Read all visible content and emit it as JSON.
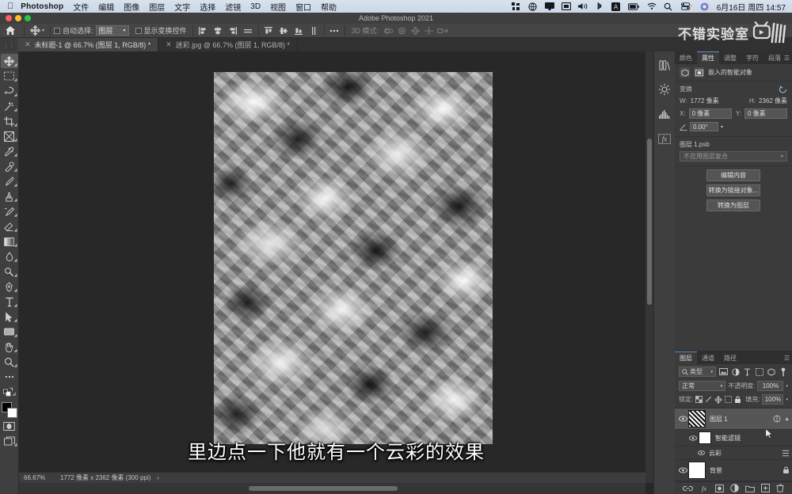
{
  "macbar": {
    "apple": "apple-logo",
    "app_name": "Photoshop",
    "menus": [
      "文件",
      "编辑",
      "图像",
      "图层",
      "文字",
      "选择",
      "滤镜",
      "3D",
      "视图",
      "窗口",
      "帮助"
    ],
    "status_icons": [
      "grid-icon",
      "globe-icon",
      "display-icon",
      "screen-icon",
      "volume-icon",
      "bluetooth-icon",
      "input-source-icon",
      "battery-icon",
      "wifi-icon",
      "search-icon",
      "control-center-icon",
      "siri-icon"
    ],
    "clock": "6月16日 周四  14:57"
  },
  "titlebar": {
    "title": "Adobe Photoshop 2021"
  },
  "optionsbar": {
    "home_icon": "home-icon",
    "tool_icon": "move-tool-icon",
    "auto_select_label": "自动选择:",
    "auto_select_value": "图层",
    "show_transform_label": "显示变换控件",
    "align_icons": [
      "align-left-icon",
      "align-center-h-icon",
      "align-right-icon",
      "distribute-h-icon",
      "align-top-icon",
      "align-middle-v-icon",
      "align-bottom-icon",
      "distribute-v-icon"
    ],
    "more_icon": "more-options-icon",
    "three_d_label": "3D 模式:",
    "three_d_icons": [
      "orbit-3d-icon",
      "roll-3d-icon",
      "pan-3d-icon",
      "slide-3d-icon",
      "scale-3d-icon"
    ]
  },
  "tabs": [
    {
      "label": "未标题-1 @ 66.7% (图层 1, RGB/8) *",
      "active": true
    },
    {
      "label": "迷彩.jpg @ 66.7% (图层 1, RGB/8) *",
      "active": false
    }
  ],
  "toolbar": {
    "tools": [
      {
        "name": "move-tool",
        "selected": true
      },
      {
        "name": "marquee-tool",
        "selected": false
      },
      {
        "name": "lasso-tool",
        "selected": false
      },
      {
        "name": "magic-wand-tool",
        "selected": false
      },
      {
        "name": "crop-tool",
        "selected": false
      },
      {
        "name": "frame-tool",
        "selected": false
      },
      {
        "name": "eyedropper-tool",
        "selected": false
      },
      {
        "name": "healing-brush-tool",
        "selected": false
      },
      {
        "name": "brush-tool",
        "selected": false
      },
      {
        "name": "clone-stamp-tool",
        "selected": false
      },
      {
        "name": "history-brush-tool",
        "selected": false
      },
      {
        "name": "eraser-tool",
        "selected": false
      },
      {
        "name": "gradient-tool",
        "selected": false
      },
      {
        "name": "blur-tool",
        "selected": false
      },
      {
        "name": "dodge-tool",
        "selected": false
      },
      {
        "name": "pen-tool",
        "selected": false
      },
      {
        "name": "type-tool",
        "selected": false
      },
      {
        "name": "path-selection-tool",
        "selected": false
      },
      {
        "name": "shape-tool",
        "selected": false
      },
      {
        "name": "hand-tool",
        "selected": false
      },
      {
        "name": "zoom-tool",
        "selected": false
      },
      {
        "name": "edit-toolbar",
        "selected": false
      }
    ],
    "foreground_color": "#000000",
    "background_color": "#ffffff",
    "quick_mask": "quick-mask-icon",
    "screen_mode": "screen-mode-icon"
  },
  "watermark": {
    "text": "不错实验室",
    "logo": "bilibili-logo"
  },
  "subtitle": {
    "text": "里边点一下他就有一个云彩的效果"
  },
  "statusbar": {
    "zoom": "66.67%",
    "dimensions": "1772 像素 x 2362 像素 (300 ppi)",
    "arrow": "›"
  },
  "dockrail": {
    "icons": [
      "libraries-icon",
      "adjustments-icon",
      "histogram-icon",
      "styles-fx-icon"
    ]
  },
  "properties": {
    "tabs": [
      {
        "label": "颜色",
        "active": false
      },
      {
        "label": "属性",
        "active": true
      },
      {
        "label": "调整",
        "active": false
      },
      {
        "label": "字符",
        "active": false
      },
      {
        "label": "段落",
        "active": false
      }
    ],
    "menu_icon": "panel-menu-icon",
    "header_icons": [
      "smart-object-icon",
      "mask-icon"
    ],
    "header_label": "嵌入的智能对象",
    "transform_title": "变换",
    "reset_icon": "reset-icon",
    "w_label": "W:",
    "w_value": "1772 像素",
    "h_label": "H:",
    "h_value": "2362 像素",
    "x_label": "X:",
    "x_value": "0 像素",
    "y_label": "Y:",
    "y_value": "0 像素",
    "angle_icon": "angle-icon",
    "angle_value": "0.00°",
    "psb_name": "图层 1.psb",
    "comp_placeholder": "不应用图层复合",
    "buttons": [
      "编辑内容",
      "转换为链接对象...",
      "转换为图层"
    ]
  },
  "layers": {
    "tabs": [
      {
        "label": "图层",
        "active": true
      },
      {
        "label": "通道",
        "active": false
      },
      {
        "label": "路径",
        "active": false
      }
    ],
    "menu_icon": "panel-menu-icon",
    "filter_label": "类型",
    "filter_search_icon": "search-icon",
    "filter_icons": [
      "filter-image-icon",
      "filter-adjustment-icon",
      "filter-type-icon",
      "filter-shape-icon",
      "filter-smart-icon"
    ],
    "filter_toggle": "filter-toggle-icon",
    "blend_mode": "正常",
    "opacity_label": "不透明度:",
    "opacity_value": "100%",
    "lock_label": "锁定:",
    "lock_icons": [
      "lock-transparent-icon",
      "lock-image-icon",
      "lock-position-icon",
      "lock-artboard-icon",
      "lock-all-icon"
    ],
    "fill_label": "填充:",
    "fill_value": "100%",
    "rows": [
      {
        "name": "图层 1",
        "kind": "smart-object",
        "visible": true,
        "selected": true,
        "right_icons": [
          "smart-object-badge-icon",
          "expand-chevron-icon"
        ]
      },
      {
        "name": "智能滤镜",
        "kind": "smart-filter-group",
        "visible": true,
        "selected": false,
        "right_icons": []
      },
      {
        "name": "云彩",
        "kind": "smart-filter",
        "visible": true,
        "selected": false,
        "right_icons": [
          "filter-options-icon"
        ]
      },
      {
        "name": "背景",
        "kind": "background",
        "visible": true,
        "selected": false,
        "right_icons": [
          "lock-icon"
        ]
      }
    ],
    "footer_icons": [
      "link-layers-icon",
      "layer-style-fx-icon",
      "add-mask-icon",
      "adjustment-layer-icon",
      "new-group-icon",
      "new-layer-icon",
      "delete-layer-icon"
    ]
  },
  "colors": {
    "panel_bg": "#3b3b3b",
    "toolbar_bg": "#3f3f3f",
    "canvas_bg": "#282828",
    "accent": "#5b8ec9",
    "text": "#d0d0d0"
  }
}
